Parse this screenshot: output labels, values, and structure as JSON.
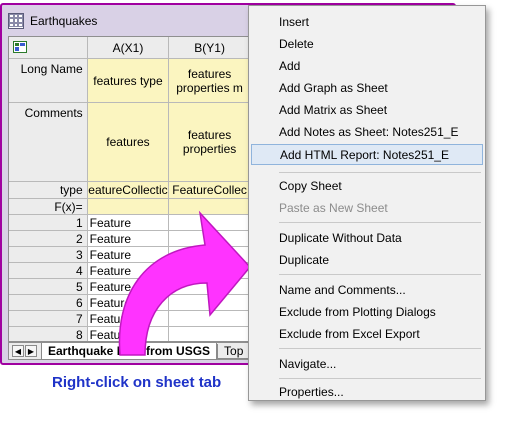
{
  "window": {
    "title": "Earthquakes"
  },
  "sheet": {
    "col_headers": [
      "A(X1)",
      "B(Y1)"
    ],
    "row_labels": {
      "long_name": "Long Name",
      "comments": "Comments",
      "type": "type",
      "fx": "F(x)="
    },
    "long_name": [
      "features type",
      "features properties m"
    ],
    "comments": [
      "features",
      "features properties"
    ],
    "type": [
      "eatureCollectic",
      "FeatureCollec"
    ],
    "rows": [
      {
        "n": "1",
        "a": "Feature"
      },
      {
        "n": "2",
        "a": "Feature"
      },
      {
        "n": "3",
        "a": "Feature"
      },
      {
        "n": "4",
        "a": "Feature"
      },
      {
        "n": "5",
        "a": "Feature"
      },
      {
        "n": "6",
        "a": "Feature"
      },
      {
        "n": "7",
        "a": "Feature"
      },
      {
        "n": "8",
        "a": "Feature"
      }
    ],
    "tabs": [
      "Earthquake Data from USGS",
      "Top"
    ]
  },
  "caption": "Right-click on sheet tab",
  "menu": {
    "items": [
      {
        "label": "Insert",
        "u": "I",
        "rest": "nsert"
      },
      {
        "label": "Delete",
        "u": "D",
        "rest": "elete"
      },
      {
        "label": "Add"
      },
      {
        "label": "Add Graph as Sheet"
      },
      {
        "label": "Add Matrix as Sheet"
      },
      {
        "label": "Add Notes as Sheet: Notes251_E"
      },
      {
        "label": "Add HTML Report: Notes251_E"
      },
      {
        "label": "Copy Sheet"
      },
      {
        "label": "Paste as New Sheet"
      },
      {
        "label": "Duplicate Without Data"
      },
      {
        "label": "Duplicate"
      },
      {
        "label": "Name and Comments..."
      },
      {
        "label": "Exclude from Plotting Dialogs"
      },
      {
        "label": "Exclude from Excel Export"
      },
      {
        "label": "Navigate..."
      },
      {
        "label": "Properties..."
      }
    ]
  },
  "colors": {
    "accent_border": "#a000a0",
    "caption": "#1f33c8",
    "arrow": "#ff33ff",
    "highlight": "#dfe9f5"
  }
}
